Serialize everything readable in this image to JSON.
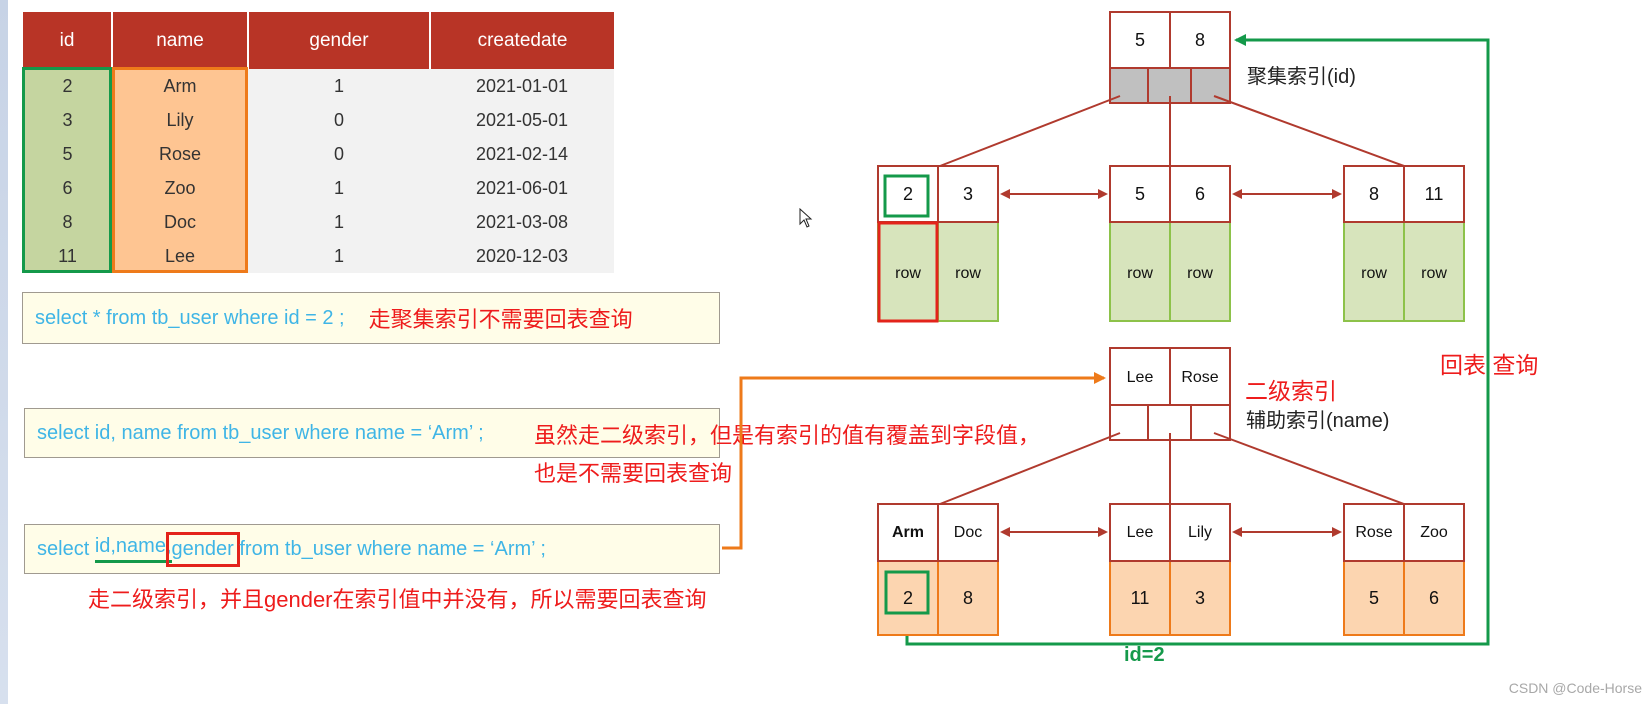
{
  "table": {
    "columns": [
      "id",
      "name",
      "gender",
      "createdate"
    ],
    "rows": [
      [
        "2",
        "Arm",
        "1",
        "2021-01-01"
      ],
      [
        "3",
        "Lily",
        "0",
        "2021-05-01"
      ],
      [
        "5",
        "Rose",
        "0",
        "2021-02-14"
      ],
      [
        "6",
        "Zoo",
        "1",
        "2021-06-01"
      ],
      [
        "8",
        "Doc",
        "1",
        "2021-03-08"
      ],
      [
        "11",
        "Lee",
        "1",
        "2020-12-03"
      ]
    ],
    "id_column_highlight_color": "#14994a",
    "name_column_highlight_color": "#ee7a1a"
  },
  "queries": [
    {
      "sql": "select * from tb_user where id = 2 ;",
      "note": "走聚集索引不需要回表查询"
    },
    {
      "sql": "select id, name from tb_user where name = ‘Arm’ ;",
      "note_line1": "虽然走二级索引，但是有索引的值有覆盖到字段值，",
      "note_line2": "也是不需要回表查询"
    },
    {
      "sql_prefix": "select ",
      "sql_covered": "id,name,",
      "sql_uncovered": "gender",
      "sql_suffix": " from tb_user where name = ‘Arm’ ;",
      "note": "走二级索引，并且gender在索引值中并没有，所以需要回表查询"
    }
  ],
  "clustered_index": {
    "label": "聚集索引(id)",
    "root_keys": [
      "5",
      "8"
    ],
    "leaves": [
      {
        "keys": [
          "2",
          "3"
        ],
        "rows": [
          "row",
          "row"
        ]
      },
      {
        "keys": [
          "5",
          "6"
        ],
        "rows": [
          "row",
          "row"
        ]
      },
      {
        "keys": [
          "8",
          "11"
        ],
        "rows": [
          "row",
          "row"
        ]
      }
    ]
  },
  "secondary_index": {
    "label_red": "二级索引",
    "label": "辅助索引(name)",
    "root_keys": [
      "Lee",
      "Rose"
    ],
    "leaves": [
      {
        "keys": [
          "Arm",
          "Doc"
        ],
        "ids": [
          "2",
          "8"
        ]
      },
      {
        "keys": [
          "Lee",
          "Lily"
        ],
        "ids": [
          "11",
          "3"
        ]
      },
      {
        "keys": [
          "Rose",
          "Zoo"
        ],
        "ids": [
          "5",
          "6"
        ]
      }
    ]
  },
  "lookup": {
    "label": "回表 查询",
    "id_label": "id=2"
  },
  "colors": {
    "header_red": "#b83426",
    "node_border": "#b03a2e",
    "green": "#14994a",
    "orange": "#ee7a1a",
    "row_fill": "#d7e4bc",
    "id_fill": "#fcd5b0",
    "sql_text": "#3fb5e6",
    "note_red": "#ee1c1c"
  },
  "watermark": "CSDN @Code-Horse"
}
